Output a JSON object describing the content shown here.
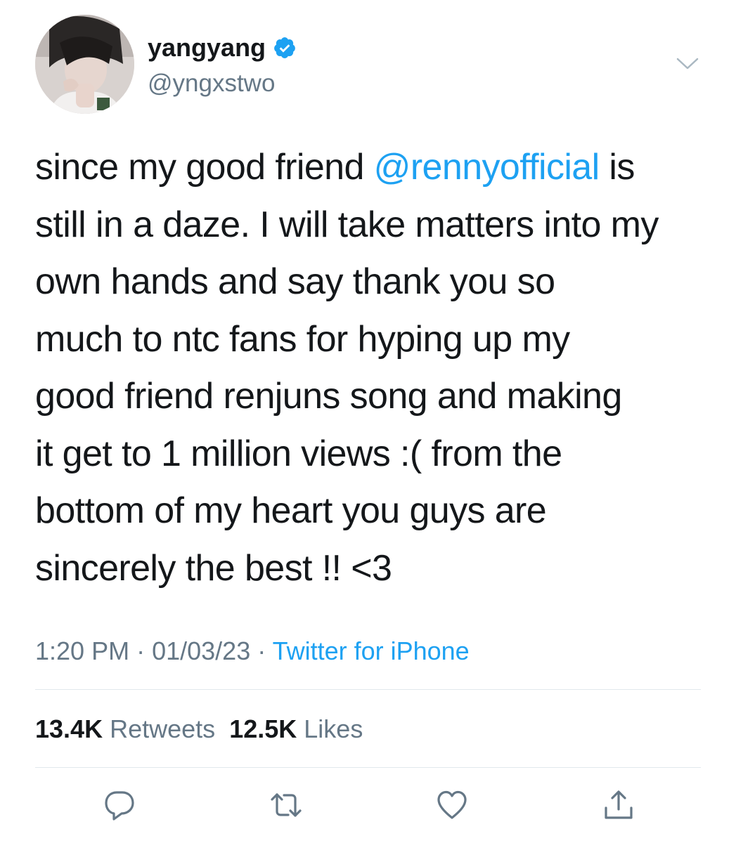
{
  "user": {
    "display_name": "yangyang",
    "handle": "@yngxstwo",
    "verified_icon": "verified-badge-icon"
  },
  "tweet": {
    "lines": [
      [
        "since my good friend ",
        "@rennyofficial",
        " is"
      ],
      "still in a daze. I will take matters into my",
      "own hands and say thank you so",
      "much to ntc fans for hyping up my",
      "good friend renjuns song and making",
      "it get to 1 million views :( from the",
      "bottom of my heart you guys are",
      "sincerely the best !! <3"
    ],
    "mention": "@rennyofficial"
  },
  "meta": {
    "time": "1:20 PM",
    "separator": " · ",
    "date": "01/03/23",
    "source": "Twitter for iPhone"
  },
  "stats": {
    "retweets_count": "13.4K",
    "retweets_label": "Retweets",
    "likes_count": "12.5K",
    "likes_label": "Likes"
  },
  "actions": {
    "reply": "reply-icon",
    "retweet": "retweet-icon",
    "like": "heart-icon",
    "share": "share-icon"
  },
  "colors": {
    "accent": "#1da1f2",
    "text": "#14171a",
    "secondary": "#657786",
    "divider": "#e1e8ed"
  }
}
